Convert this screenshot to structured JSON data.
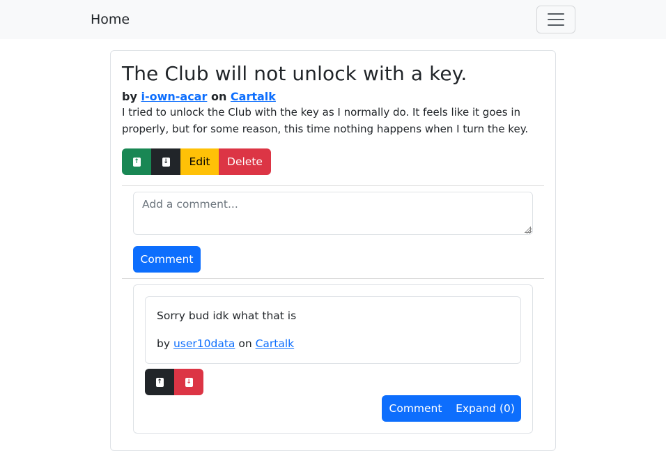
{
  "navbar": {
    "brand": "Home",
    "toggle_icon": "hamburger-menu-icon"
  },
  "post": {
    "title": "The Club will not unlock with a key.",
    "by_label": "by",
    "author": "i-own-acar",
    "on_label": "on",
    "community": "Cartalk",
    "body": "I tried to unlock the Club with the key as I normally do. It feels like it goes in properly, but for some reason, this time nothing happens when I turn the key.",
    "actions": {
      "upvote_icon": "arrow-up-icon",
      "downvote_icon": "arrow-down-icon",
      "edit_label": "Edit",
      "delete_label": "Delete"
    }
  },
  "new_comment": {
    "placeholder": "Add a comment...",
    "value": "",
    "submit_label": "Comment"
  },
  "comments": [
    {
      "text": "Sorry bud idk what that is",
      "by_label": "by",
      "author": "user10data",
      "on_label": "on",
      "community": "Cartalk",
      "upvote_icon": "arrow-up-icon",
      "downvote_icon": "arrow-down-icon",
      "reply_label": "Comment",
      "expand_label": "Expand (0)"
    }
  ],
  "colors": {
    "primary": "#0d6efd",
    "success": "#198754",
    "dark": "#212529",
    "warning": "#ffc107",
    "danger": "#dc3545",
    "navbar_bg": "#f8f9fa"
  }
}
